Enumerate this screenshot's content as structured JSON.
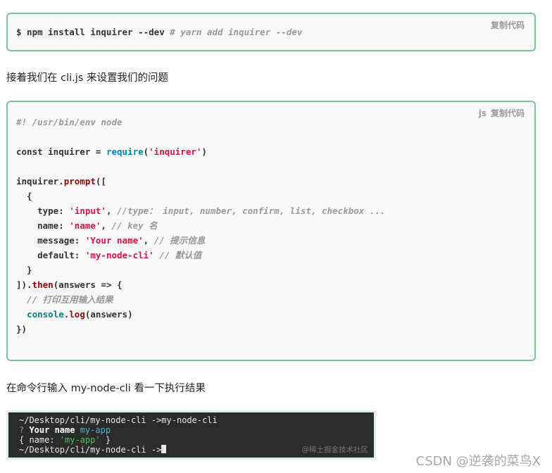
{
  "box1": {
    "copy_label": "复制代码",
    "cmd": "$ npm install inquirer --dev",
    "comment": "# yarn add inquirer --dev"
  },
  "para1": "接着我们在 cli.js 来设置我们的问题",
  "box2": {
    "lang": "js",
    "copy_label": "复制代码",
    "shebang": "#! /usr/bin/env node",
    "l3_a": "const inquirer = ",
    "l3_require": "require",
    "l3_b": "(",
    "l3_str": "'inquirer'",
    "l3_c": ")",
    "l5_a": "inquirer.",
    "l5_prompt": "prompt",
    "l5_b": "([",
    "l6": "  {",
    "l7_key": "    type: ",
    "l7_str": "'input'",
    "l7_sep": ", ",
    "l7_cm": "//type： input, number, confirm, list, checkbox ...",
    "l8_key": "    name: ",
    "l8_str": "'name'",
    "l8_sep": ", ",
    "l8_cm": "// key 名",
    "l9_key": "    message: ",
    "l9_str": "'Your name'",
    "l9_sep": ", ",
    "l9_cm": "// 提示信息",
    "l10_key": "    default: ",
    "l10_str": "'my-node-cli'",
    "l10_sep": " ",
    "l10_cm": "// 默认值",
    "l11": "  }",
    "l12_a": "]).",
    "l12_then": "then",
    "l12_b": "(answers => {",
    "l13_cm": "  // 打印互用输入结果",
    "l14_indent": "  ",
    "l14_console": "console",
    "l14_dot": ".",
    "l14_log": "log",
    "l14_b": "(answers)",
    "l15": "})"
  },
  "para2": "在命令行输入 my-node-cli 看一下执行结果",
  "terminal": {
    "line1": "~/Desktop/cli/my-node-cli ->my-node-cli",
    "line2_q": "? ",
    "line2_label": "Your name ",
    "line2_answer": "my-app",
    "line3_a": "{ name: ",
    "line3_str": "'my-app'",
    "line3_b": " }",
    "line4": "~/Desktop/cli/my-node-cli ->",
    "juejin": "@稀土掘金技术社区"
  },
  "watermark": "CSDN @逆袭的菜鸟X"
}
